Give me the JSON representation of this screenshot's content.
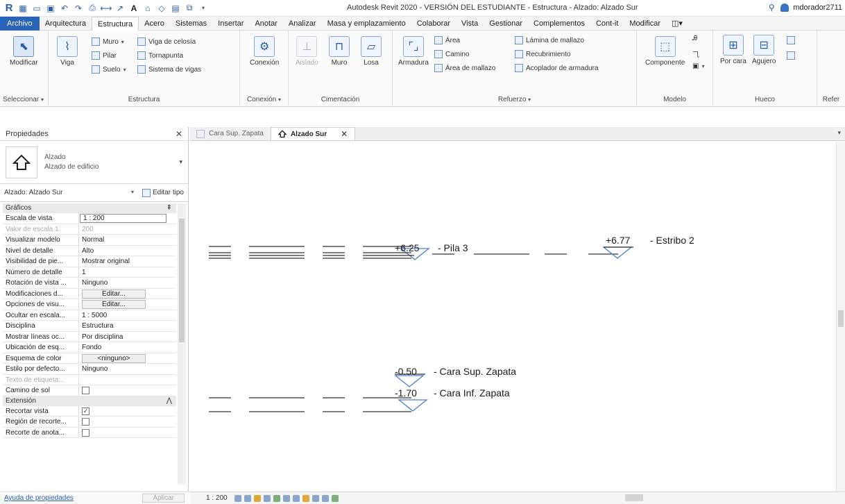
{
  "window": {
    "title": "Autodesk Revit 2020 - VERSIÓN DEL ESTUDIANTE - Estructura - Alzado: Alzado Sur",
    "user": "mdorador2711"
  },
  "ribbon": {
    "tabs": [
      "Archivo",
      "Arquitectura",
      "Estructura",
      "Acero",
      "Sistemas",
      "Insertar",
      "Anotar",
      "Analizar",
      "Masa y emplazamiento",
      "Colaborar",
      "Vista",
      "Gestionar",
      "Complementos",
      "Cont-it",
      "Modificar"
    ],
    "active_tab": "Estructura",
    "groups": {
      "select": {
        "modify": "Modificar",
        "label": "Seleccionar"
      },
      "structure": {
        "beam": "Viga",
        "wall": "Muro",
        "column": "Pilar",
        "floor": "Suelo",
        "truss": "Viga de celosía",
        "brace": "Tornapunta",
        "beam_system": "Sistema de vigas",
        "label": "Estructura"
      },
      "connection": {
        "connection": "Conexión",
        "label": "Conexión"
      },
      "foundation": {
        "isolated": "Aislado",
        "wall": "Muro",
        "slab": "Losa",
        "label": "Cimentación"
      },
      "reinforcement": {
        "rebar": "Armadura",
        "area": "Área",
        "path": "Camino",
        "fabric_area": "Área de mallazo",
        "fabric_sheet": "Lámina de mallazo",
        "cover": "Recubrimiento",
        "coupler": "Acoplador de armadura",
        "label": "Refuerzo"
      },
      "model": {
        "component": "Componente",
        "label": "Modelo"
      },
      "opening": {
        "by_face": "Por cara",
        "shaft": "Agujero",
        "label": "Hueco"
      },
      "ref": {
        "label": "Refer"
      }
    }
  },
  "properties": {
    "title": "Propiedades",
    "type_name": "Alzado",
    "type_sub": "Alzado de edificio",
    "instance": "Alzado: Alzado Sur",
    "edit_type": "Editar tipo",
    "sections": [
      {
        "name": "Gráficos",
        "rows": [
          {
            "name": "Escala de vista",
            "value": "1 : 200",
            "style": "input"
          },
          {
            "name": "Valor de escala    1:",
            "value": "200",
            "style": "dim"
          },
          {
            "name": "Visualizar modelo",
            "value": "Normal"
          },
          {
            "name": "Nivel de detalle",
            "value": "Alto"
          },
          {
            "name": "Visibilidad de pie...",
            "value": "Mostrar original"
          },
          {
            "name": "Número de detalle",
            "value": "1"
          },
          {
            "name": "Rotación de vista ...",
            "value": "Ninguno"
          },
          {
            "name": "Modificaciones d...",
            "value": "Editar...",
            "style": "button"
          },
          {
            "name": "Opciones de visu...",
            "value": "Editar...",
            "style": "button"
          },
          {
            "name": "Ocultar en escala...",
            "value": "1 : 5000"
          },
          {
            "name": "Disciplina",
            "value": "Estructura"
          },
          {
            "name": "Mostrar líneas oc...",
            "value": "Por disciplina"
          },
          {
            "name": "Ubicación de esq...",
            "value": "Fondo"
          },
          {
            "name": "Esquema de color",
            "value": "<ninguno>",
            "style": "button"
          },
          {
            "name": "Estilo por defecto...",
            "value": "Ninguno"
          },
          {
            "name": "Texto de etiqueta...",
            "value": "",
            "style": "dim"
          },
          {
            "name": "Camino de sol",
            "value": "",
            "style": "check"
          }
        ]
      },
      {
        "name": "Extensión",
        "rows": [
          {
            "name": "Recortar vista",
            "value": "✓",
            "style": "check"
          },
          {
            "name": "Región de recorte...",
            "value": "",
            "style": "check"
          },
          {
            "name": "Recorte de anota...",
            "value": "",
            "style": "check"
          }
        ]
      }
    ],
    "help_link": "Ayuda de propiedades",
    "apply": "Aplicar"
  },
  "view_tabs": [
    {
      "label": "Cara Sup. Zapata",
      "active": false
    },
    {
      "label": "Alzado Sur",
      "active": true
    }
  ],
  "levels": [
    {
      "value": "+6.25",
      "name": "Pila 3"
    },
    {
      "value": "+6.77",
      "name": "Estribo 2"
    },
    {
      "value": "-0.50",
      "name": "Cara Sup. Zapata"
    },
    {
      "value": "-1.70",
      "name": "Cara Inf. Zapata"
    }
  ],
  "status": {
    "scale": "1 : 200"
  }
}
